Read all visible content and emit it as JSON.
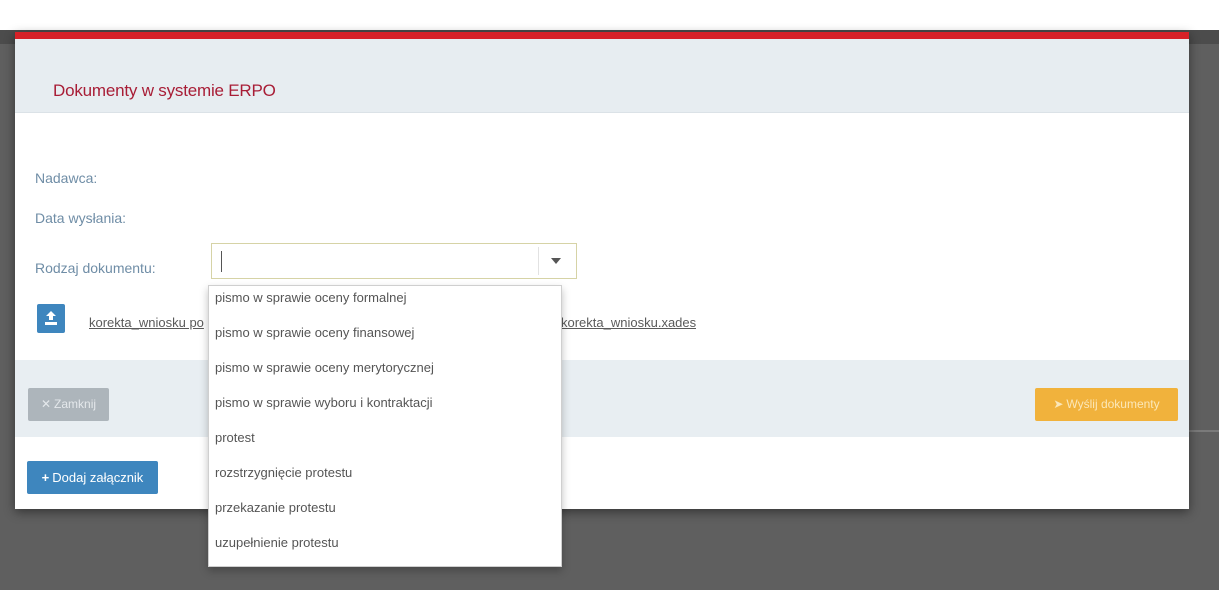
{
  "modal": {
    "title": "Dokumenty w systemie ERPO",
    "fields": {
      "sender_label": "Nadawca:",
      "date_label": "Data wysłania:",
      "doc_type_label": "Rodzaj dokumentu:"
    },
    "doc_type_select": {
      "value": ""
    },
    "attachments": {
      "left_link": "korekta_wniosku po",
      "right_link": "korekta_wniosku.xades"
    },
    "footer": {
      "close_label": "Zamknij",
      "send_label": "Wyślij dokumenty"
    },
    "add_attachment_label": "Dodaj załącznik"
  },
  "dropdown": {
    "options": [
      "pismo w sprawie oceny formalnej",
      "pismo w sprawie oceny finansowej",
      "pismo w sprawie oceny merytorycznej",
      "pismo w sprawie wyboru i kontraktacji",
      "protest",
      "rozstrzygnięcie protestu",
      "przekazanie protestu",
      "uzupełnienie protestu"
    ]
  },
  "colors": {
    "accent_red": "#d62128",
    "title_red": "#a81d36",
    "primary_blue": "#3e86be",
    "warning_orange": "#f1b23c"
  },
  "icons": {
    "upload": "upload-icon",
    "close": "close-icon",
    "send": "paper-plane-icon",
    "add": "plus-icon",
    "select_arrow": "caret-down-icon"
  }
}
